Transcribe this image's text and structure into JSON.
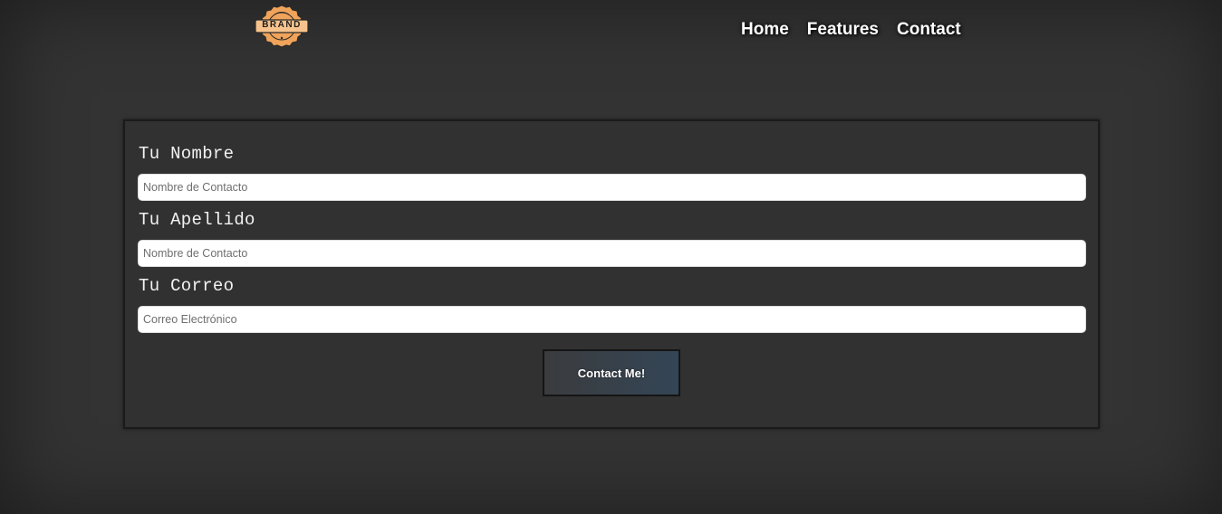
{
  "header": {
    "logo_text": "BRAND",
    "nav": [
      {
        "label": "Home"
      },
      {
        "label": "Features"
      },
      {
        "label": "Contact"
      }
    ]
  },
  "form": {
    "fields": [
      {
        "label": "Tu Nombre",
        "placeholder": "Nombre de Contacto",
        "value": ""
      },
      {
        "label": "Tu Apellido",
        "placeholder": "Nombre de Contacto",
        "value": ""
      },
      {
        "label": "Tu Correo",
        "placeholder": "Correo Electrónico",
        "value": ""
      }
    ],
    "submit_label": "Contact Me!"
  },
  "colors": {
    "background": "#333333",
    "logo_orange": "#f0a35a",
    "button_gradient_start": "#3b3c3e",
    "button_gradient_end": "#344556"
  },
  "icons": {
    "logo": "brand-badge-logo"
  }
}
